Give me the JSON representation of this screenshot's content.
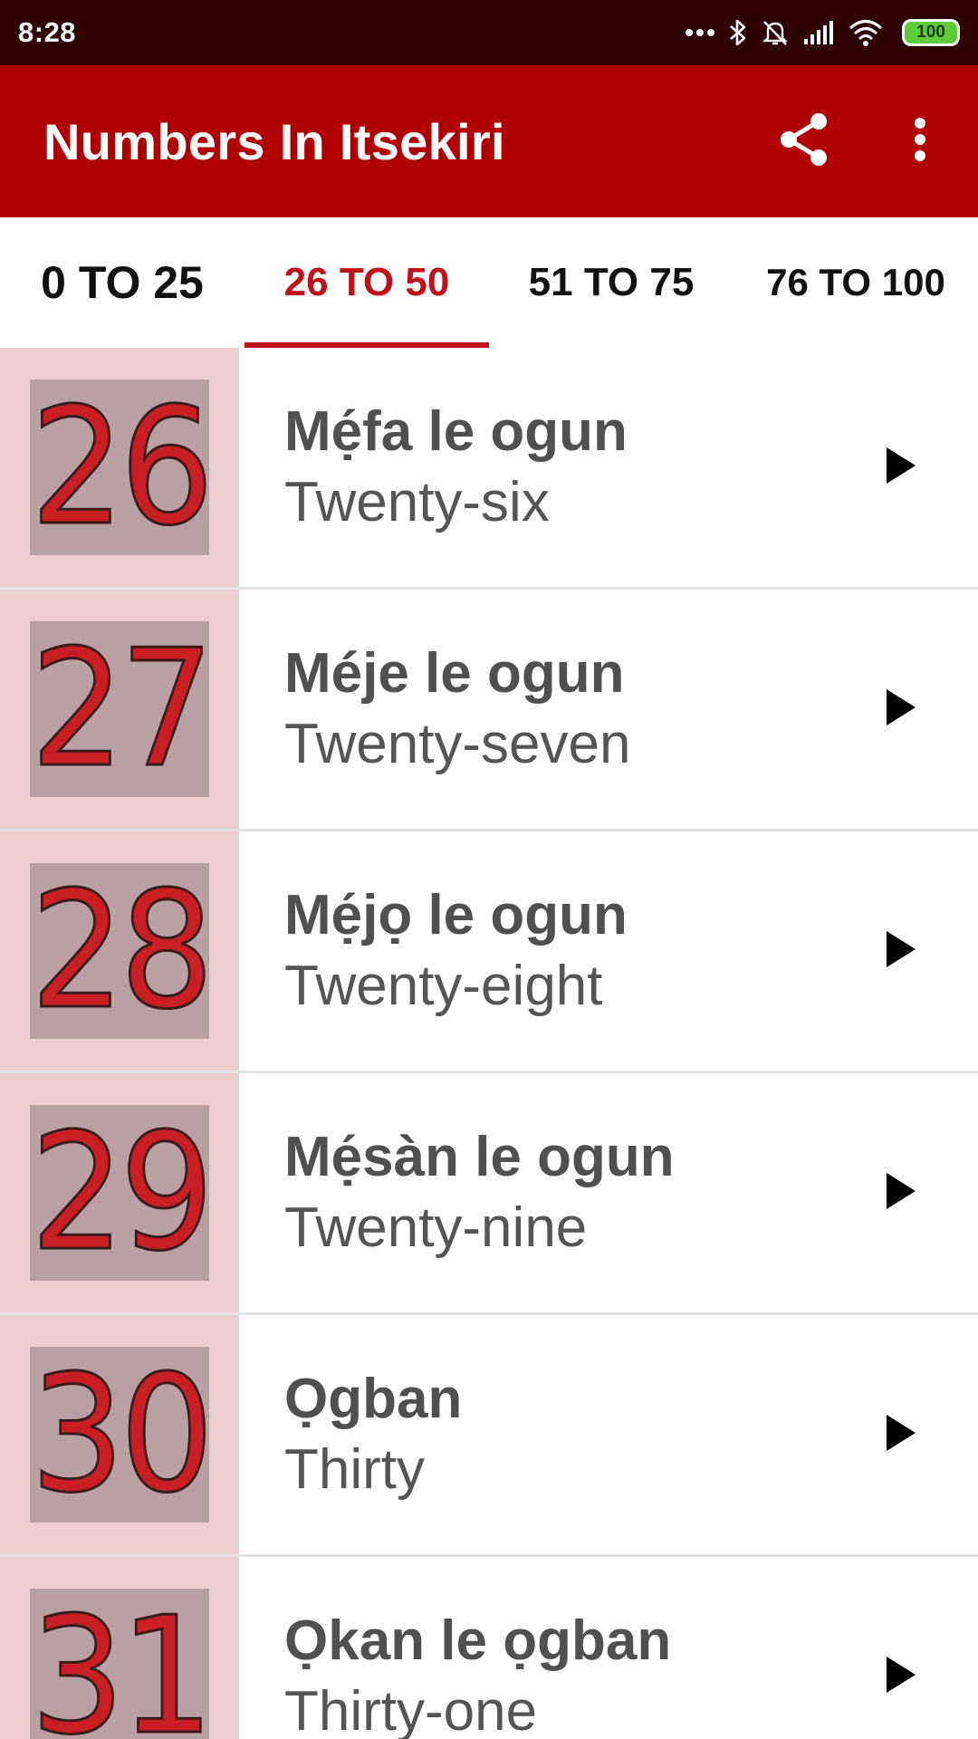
{
  "status_bar": {
    "time": "8:28",
    "battery": "100",
    "icons": [
      "more-dots-icon",
      "bluetooth-icon",
      "mute-bell-icon",
      "signal-icon",
      "wifi-icon",
      "battery-icon"
    ]
  },
  "app_bar": {
    "title": "Numbers In Itsekiri",
    "actions": [
      "share-icon",
      "more-vert-icon"
    ]
  },
  "tabs": [
    {
      "label": "0 TO 25",
      "active": false
    },
    {
      "label": "26 TO 50",
      "active": true
    },
    {
      "label": "51 TO 75",
      "active": false
    },
    {
      "label": "76 TO 100",
      "active": false
    }
  ],
  "items": [
    {
      "number": "26",
      "itsekiri": "Mẹ́fa le ogun",
      "english": "Twenty-six"
    },
    {
      "number": "27",
      "itsekiri": "Méje le ogun",
      "english": "Twenty-seven"
    },
    {
      "number": "28",
      "itsekiri": "Mẹ́jọ le ogun",
      "english": "Twenty-eight"
    },
    {
      "number": "29",
      "itsekiri": "Mẹ́sàn le ogun",
      "english": "Twenty-nine"
    },
    {
      "number": "30",
      "itsekiri": "Ọgban",
      "english": "Thirty"
    },
    {
      "number": "31",
      "itsekiri": "Ọkan le ọgban",
      "english": "Thirty-one"
    }
  ],
  "colors": {
    "status_bar": "#2e0002",
    "app_bar": "#b00003",
    "accent": "#c0101a",
    "number_cell": "#ebcfd0",
    "number_box": "#b9a1a3",
    "number_digits": "#c81e24"
  }
}
